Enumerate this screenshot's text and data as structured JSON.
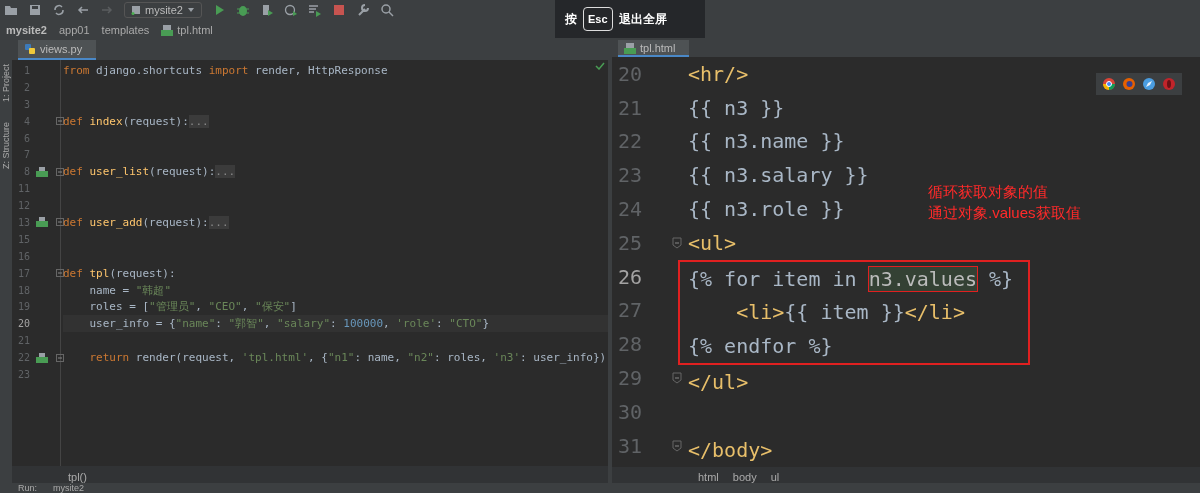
{
  "toolbar": {
    "run_config": "mysite2"
  },
  "fullscreen_hint": {
    "prefix": "按",
    "key": "Esc",
    "suffix": "退出全屏"
  },
  "breadcrumb": [
    {
      "label": "mysite2",
      "kind": "project"
    },
    {
      "label": "app01",
      "kind": "dir"
    },
    {
      "label": "templates",
      "kind": "dir"
    },
    {
      "label": "tpl.html",
      "kind": "file"
    }
  ],
  "side_strip": [
    "1: Project",
    "Z: Structure"
  ],
  "left_editor": {
    "tabs": [
      {
        "label": "views.py",
        "selected": true
      }
    ],
    "lines": [
      {
        "n": "1",
        "fold": false,
        "marker": false,
        "current": false,
        "tokens": [
          {
            "t": "from",
            "kind": "kw"
          },
          {
            "t": " django.shortcuts ",
            "kind": "plain"
          },
          {
            "t": "import",
            "kind": "kw"
          },
          {
            "t": " render, HttpResponse",
            "kind": "plain"
          }
        ]
      },
      {
        "n": "2",
        "fold": false,
        "marker": false,
        "current": false
      },
      {
        "n": "3",
        "fold": false,
        "marker": false,
        "current": false
      },
      {
        "n": "4",
        "fold": true,
        "marker": false,
        "current": false,
        "tokens": [
          {
            "t": "def",
            "kind": "kw"
          },
          {
            "t": " index",
            "kind": "fn"
          },
          {
            "t": "(request):",
            "kind": "plain"
          },
          {
            "t": "...",
            "kind": "folded"
          }
        ]
      },
      {
        "n": "6",
        "fold": false,
        "marker": false,
        "current": false
      },
      {
        "n": "7",
        "fold": false,
        "marker": false,
        "current": false
      },
      {
        "n": "8",
        "fold": true,
        "marker": true,
        "current": false,
        "tokens": [
          {
            "t": "def",
            "kind": "kw"
          },
          {
            "t": " user_list",
            "kind": "fn"
          },
          {
            "t": "(request):",
            "kind": "plain"
          },
          {
            "t": "...",
            "kind": "folded"
          }
        ]
      },
      {
        "n": "11",
        "fold": false,
        "marker": false,
        "current": false
      },
      {
        "n": "12",
        "fold": false,
        "marker": false,
        "current": false
      },
      {
        "n": "13",
        "fold": true,
        "marker": true,
        "current": false,
        "tokens": [
          {
            "t": "def",
            "kind": "kw"
          },
          {
            "t": " user_add",
            "kind": "fn"
          },
          {
            "t": "(request):",
            "kind": "plain"
          },
          {
            "t": "...",
            "kind": "folded"
          }
        ]
      },
      {
        "n": "15",
        "fold": false,
        "marker": false,
        "current": false
      },
      {
        "n": "16",
        "fold": false,
        "marker": false,
        "current": false
      },
      {
        "n": "17",
        "fold": true,
        "marker": false,
        "current": false,
        "tokens": [
          {
            "t": "def",
            "kind": "kw"
          },
          {
            "t": " tpl",
            "kind": "fn"
          },
          {
            "t": "(request):",
            "kind": "plain"
          }
        ]
      },
      {
        "n": "18",
        "fold": false,
        "marker": false,
        "current": false,
        "tokens": [
          {
            "t": "    name = ",
            "kind": "plain"
          },
          {
            "t": "\"韩超\"",
            "kind": "str"
          }
        ]
      },
      {
        "n": "19",
        "fold": false,
        "marker": false,
        "current": false,
        "tokens": [
          {
            "t": "    roles = [",
            "kind": "plain"
          },
          {
            "t": "\"管理员\"",
            "kind": "str"
          },
          {
            "t": ", ",
            "kind": "plain"
          },
          {
            "t": "\"CEO\"",
            "kind": "str"
          },
          {
            "t": ", ",
            "kind": "plain"
          },
          {
            "t": "\"保安\"",
            "kind": "str"
          },
          {
            "t": "]",
            "kind": "plain"
          }
        ]
      },
      {
        "n": "20",
        "fold": false,
        "marker": false,
        "current": true,
        "tokens": [
          {
            "t": "    user_info = {",
            "kind": "plain"
          },
          {
            "t": "\"name\"",
            "kind": "str"
          },
          {
            "t": ": ",
            "kind": "plain"
          },
          {
            "t": "\"郭智\"",
            "kind": "str"
          },
          {
            "t": ", ",
            "kind": "plain"
          },
          {
            "t": "\"salary\"",
            "kind": "str"
          },
          {
            "t": ": ",
            "kind": "plain"
          },
          {
            "t": "100000",
            "kind": "num"
          },
          {
            "t": ", ",
            "kind": "plain"
          },
          {
            "t": "'role'",
            "kind": "str"
          },
          {
            "t": ": ",
            "kind": "plain"
          },
          {
            "t": "\"CTO\"",
            "kind": "str"
          },
          {
            "t": "}",
            "kind": "plain"
          }
        ]
      },
      {
        "n": "21",
        "fold": false,
        "marker": false,
        "current": false
      },
      {
        "n": "22",
        "fold": true,
        "marker": true,
        "current": false,
        "tokens": [
          {
            "t": "    return",
            "kind": "kw"
          },
          {
            "t": " render(request, ",
            "kind": "plain"
          },
          {
            "t": "'tpl.html'",
            "kind": "str"
          },
          {
            "t": ", {",
            "kind": "plain"
          },
          {
            "t": "\"n1\"",
            "kind": "str"
          },
          {
            "t": ": name, ",
            "kind": "plain"
          },
          {
            "t": "\"n2\"",
            "kind": "str"
          },
          {
            "t": ": roles, ",
            "kind": "plain"
          },
          {
            "t": "'n3'",
            "kind": "str"
          },
          {
            "t": ": user_info})",
            "kind": "plain"
          }
        ]
      },
      {
        "n": "23",
        "fold": false,
        "marker": false,
        "current": false
      }
    ],
    "footer": [
      "tpl()"
    ]
  },
  "right_editor": {
    "tabs": [
      {
        "label": "tpl.html",
        "selected": true
      }
    ],
    "lines": [
      {
        "n": "20",
        "fold": false,
        "current": false,
        "in_box": false,
        "tokens": [
          {
            "t": "<hr/>",
            "kind": "tag"
          }
        ]
      },
      {
        "n": "21",
        "fold": false,
        "current": false,
        "in_box": false,
        "tokens": [
          {
            "t": "{{ n3 }}",
            "kind": "plain"
          }
        ]
      },
      {
        "n": "22",
        "fold": false,
        "current": false,
        "in_box": false,
        "tokens": [
          {
            "t": "{{ n3.name }}",
            "kind": "plain"
          }
        ]
      },
      {
        "n": "23",
        "fold": false,
        "current": false,
        "in_box": false,
        "tokens": [
          {
            "t": "{{ n3.salary }}",
            "kind": "plain"
          }
        ]
      },
      {
        "n": "24",
        "fold": false,
        "current": false,
        "in_box": false,
        "tokens": [
          {
            "t": "{{ n3.role }}",
            "kind": "plain"
          }
        ]
      },
      {
        "n": "25",
        "fold": true,
        "current": false,
        "in_box": false,
        "tokens": [
          {
            "t": "<ul>",
            "kind": "tag"
          }
        ]
      },
      {
        "n": "26",
        "fold": false,
        "current": true,
        "in_box": true,
        "tokens": [
          {
            "t": "{% for item in ",
            "kind": "plain"
          },
          {
            "t": "n3.values",
            "kind": "boxed"
          },
          {
            "t": " %}",
            "kind": "plain"
          }
        ]
      },
      {
        "n": "27",
        "fold": false,
        "current": false,
        "in_box": true,
        "tokens": [
          {
            "t": "    <li>",
            "kind": "tag"
          },
          {
            "t": "{{ item }}",
            "kind": "plain"
          },
          {
            "t": "</li>",
            "kind": "tag"
          }
        ]
      },
      {
        "n": "28",
        "fold": false,
        "current": false,
        "in_box": true,
        "tokens": [
          {
            "t": "{% endfor %}",
            "kind": "plain"
          }
        ]
      },
      {
        "n": "29",
        "fold": true,
        "current": false,
        "in_box": false,
        "tokens": [
          {
            "t": "</ul>",
            "kind": "tag"
          }
        ]
      },
      {
        "n": "30",
        "fold": false,
        "current": false,
        "in_box": false
      },
      {
        "n": "31",
        "fold": true,
        "current": false,
        "in_box": false,
        "tokens": [
          {
            "t": "</body>",
            "kind": "tag"
          }
        ]
      }
    ],
    "annotation": [
      "循环获取对象的值",
      "通过对象.values获取值"
    ],
    "footer": [
      "html",
      "body",
      "ul"
    ]
  },
  "run_bar": {
    "label": "Run:",
    "config": "mysite2"
  }
}
